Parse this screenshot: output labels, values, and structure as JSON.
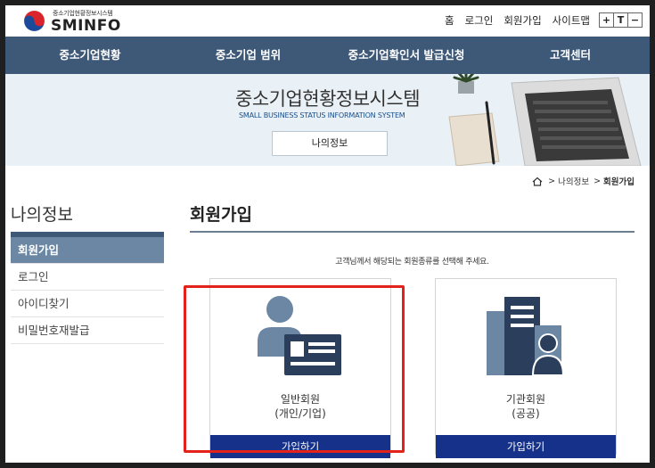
{
  "header": {
    "logo_sub": "중소기업현황정보시스템",
    "logo_text": "SMINFO",
    "util_links": [
      "홈",
      "로그인",
      "회원가입",
      "사이트맵"
    ],
    "font_size_controls": [
      "+",
      "T",
      "−"
    ]
  },
  "nav": {
    "items": [
      "중소기업현황",
      "중소기업 범위",
      "중소기업확인서 발급신청",
      "고객센터"
    ]
  },
  "banner": {
    "title": "중소기업현황정보시스템",
    "subtitle": "SMALL BUSINESS STATUS INFORMATION SYSTEM",
    "button": "나의정보"
  },
  "breadcrumb": {
    "items": [
      "나의정보",
      "회원가입"
    ],
    "separator": ">"
  },
  "sidebar": {
    "title": "나의정보",
    "items": [
      "회원가입",
      "로그인",
      "아이디찾기",
      "비밀번호재발급"
    ],
    "active": "회원가입"
  },
  "content": {
    "title": "회원가입",
    "description": "고객님께서 해당되는 회원종류를 선택해 주세요.",
    "cards": [
      {
        "line1": "일반회원",
        "line2": "(개인/기업)",
        "button": "가입하기",
        "icon": "person-id-card-icon"
      },
      {
        "line1": "기관회원",
        "line2": "(공공)",
        "button": "가입하기",
        "icon": "building-person-icon"
      }
    ]
  },
  "colors": {
    "nav_bg": "#3e5878",
    "banner_bg": "#e9f1f6",
    "sidebar_active": "#6b87a4",
    "card_button": "#15318a",
    "highlight": "#e3221b"
  }
}
